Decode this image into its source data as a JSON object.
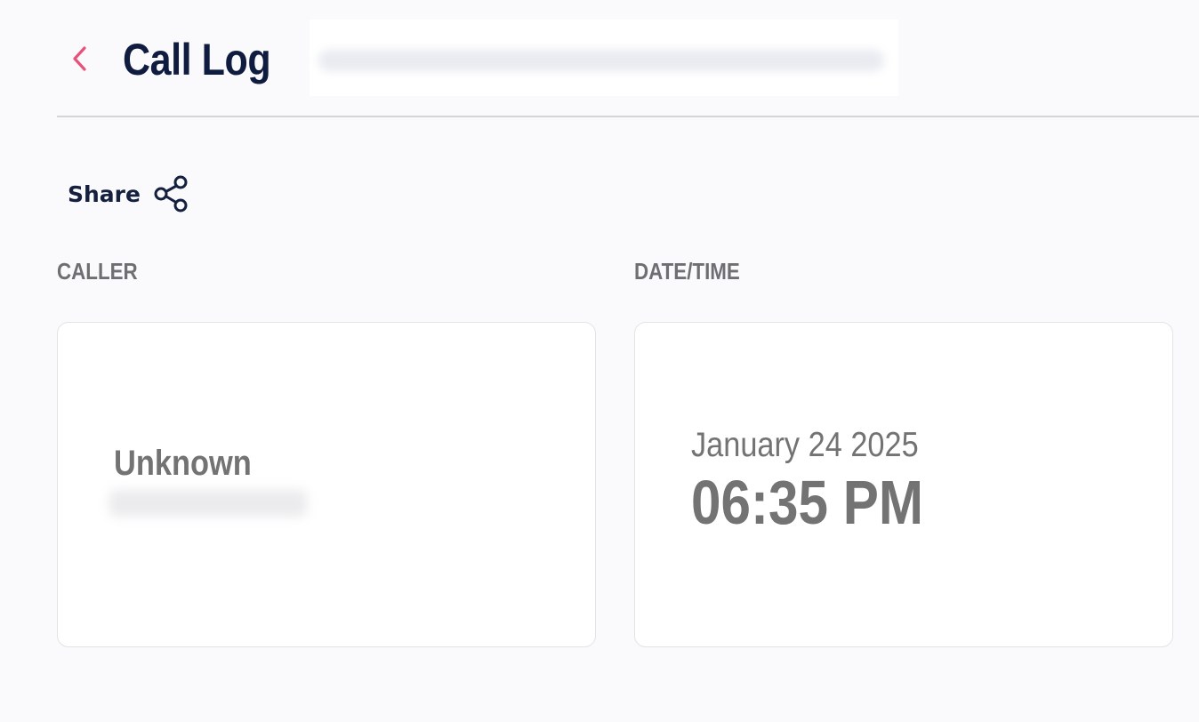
{
  "header": {
    "title": "Call Log",
    "back_icon": "chevron-left-icon",
    "accent_color": "#e8527a",
    "title_color": "#0f1c3f"
  },
  "actions": {
    "share_label": "Share",
    "share_icon": "share-icon"
  },
  "caller": {
    "label": "CALLER",
    "name": "Unknown"
  },
  "datetime": {
    "label": "DATE/TIME",
    "date": "January 24 2025",
    "time": "06:35 PM"
  }
}
